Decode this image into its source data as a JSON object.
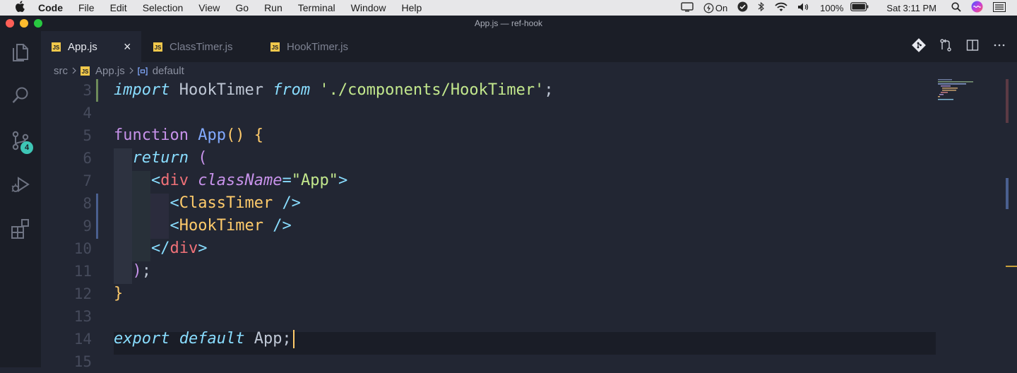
{
  "menubar": {
    "app": "Code",
    "items": [
      "File",
      "Edit",
      "Selection",
      "View",
      "Go",
      "Run",
      "Terminal",
      "Window",
      "Help"
    ],
    "status": {
      "power": "On",
      "battery": "100%",
      "clock": "Sat 3:11 PM"
    }
  },
  "window": {
    "title": "App.js — ref-hook"
  },
  "tabs": [
    {
      "label": "App.js",
      "active": true
    },
    {
      "label": "ClassTimer.js",
      "active": false
    },
    {
      "label": "HookTimer.js",
      "active": false
    }
  ],
  "tab_close": "×",
  "js_icon": "JS",
  "activity": {
    "scm_badge": "4"
  },
  "breadcrumb": {
    "folder": "src",
    "file": "App.js",
    "symbol": "default"
  },
  "editor": {
    "lines": [
      {
        "num": "3",
        "tokens": [
          [
            "kw",
            "import"
          ],
          [
            "id",
            " HookTimer "
          ],
          [
            "kw",
            "from"
          ],
          [
            "id",
            " "
          ],
          [
            "str",
            "'./components/HookTimer'"
          ],
          [
            "id",
            ";"
          ]
        ]
      },
      {
        "num": "4",
        "tokens": []
      },
      {
        "num": "5",
        "tokens": [
          [
            "kw2",
            "function"
          ],
          [
            "id",
            " "
          ],
          [
            "fn",
            "App"
          ],
          [
            "br",
            "()"
          ],
          [
            "id",
            " "
          ],
          [
            "br",
            "{"
          ]
        ]
      },
      {
        "num": "6",
        "tokens": [
          [
            "id",
            "  "
          ],
          [
            "kw",
            "return"
          ],
          [
            "id",
            " "
          ],
          [
            "pr",
            "("
          ]
        ]
      },
      {
        "num": "7",
        "tokens": [
          [
            "id",
            "    "
          ],
          [
            "pun",
            "<"
          ],
          [
            "tag",
            "div"
          ],
          [
            "id",
            " "
          ],
          [
            "attr",
            "className"
          ],
          [
            "pun",
            "="
          ],
          [
            "str",
            "\"App\""
          ],
          [
            "pun",
            ">"
          ]
        ]
      },
      {
        "num": "8",
        "tokens": [
          [
            "id",
            "      "
          ],
          [
            "pun",
            "<"
          ],
          [
            "comp",
            "ClassTimer"
          ],
          [
            "id",
            " "
          ],
          [
            "pun",
            "/>"
          ]
        ]
      },
      {
        "num": "9",
        "tokens": [
          [
            "id",
            "      "
          ],
          [
            "pun",
            "<"
          ],
          [
            "comp",
            "HookTimer"
          ],
          [
            "id",
            " "
          ],
          [
            "pun",
            "/>"
          ]
        ]
      },
      {
        "num": "10",
        "tokens": [
          [
            "id",
            "    "
          ],
          [
            "pun",
            "</"
          ],
          [
            "tag",
            "div"
          ],
          [
            "pun",
            ">"
          ]
        ]
      },
      {
        "num": "11",
        "tokens": [
          [
            "id",
            "  "
          ],
          [
            "pr",
            ")"
          ],
          [
            "id",
            ";"
          ]
        ]
      },
      {
        "num": "12",
        "tokens": [
          [
            "br",
            "}"
          ]
        ]
      },
      {
        "num": "13",
        "tokens": []
      },
      {
        "num": "14",
        "tokens": [
          [
            "kw",
            "export"
          ],
          [
            "id",
            " "
          ],
          [
            "kw",
            "default"
          ],
          [
            "id",
            " App;"
          ]
        ]
      },
      {
        "num": "15",
        "tokens": []
      }
    ]
  },
  "colors": {
    "background": "#222633",
    "keyword": "#89ddff",
    "function": "#82aaff",
    "string": "#c3e88d",
    "tag": "#f07178",
    "component": "#ffcb6b",
    "cursor": "#ffcb6b"
  },
  "icons": {
    "activity": [
      "files-icon",
      "search-icon",
      "source-control-icon",
      "run-debug-icon",
      "extensions-icon"
    ],
    "tab_actions": [
      "git-icon",
      "compare-changes-icon",
      "split-editor-icon",
      "more-actions-icon"
    ]
  }
}
